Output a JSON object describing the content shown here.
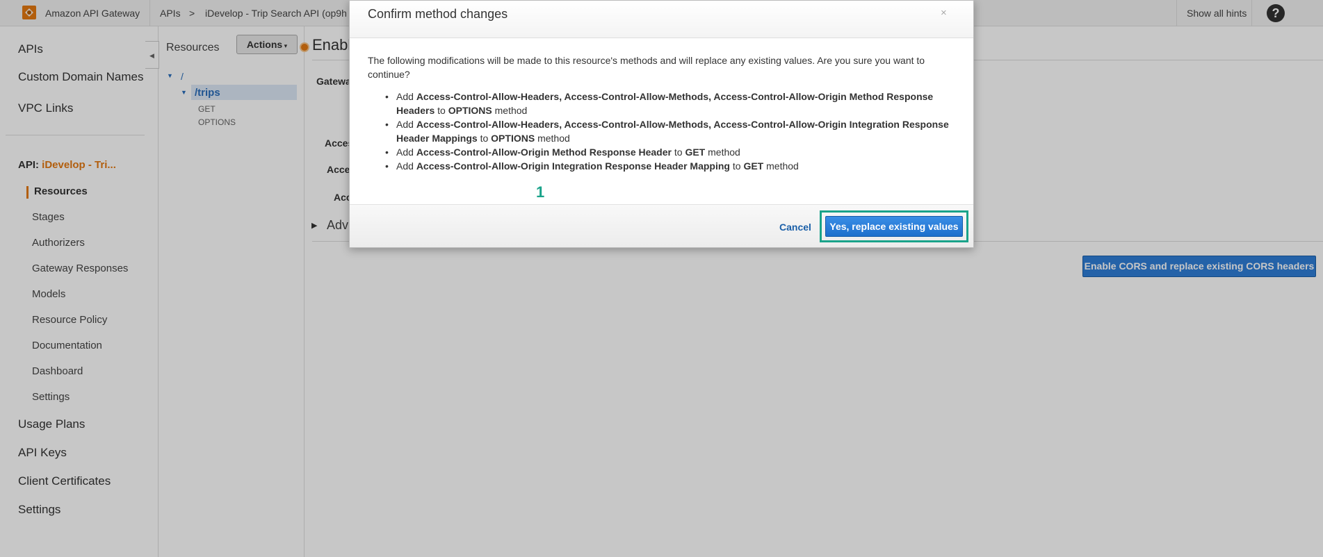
{
  "topbar": {
    "brand": "Amazon API Gateway",
    "breadcrumb_apis": "APIs",
    "breadcrumb_sep": ">",
    "breadcrumb_api": "iDevelop - Trip Search API (op9h",
    "show_hints": "Show all hints",
    "help": "?"
  },
  "leftnav": {
    "top_items": [
      "APIs",
      "Custom Domain Names",
      "VPC Links"
    ],
    "api_prefix": "API:",
    "api_name": "iDevelop - Tri...",
    "sub_items": [
      "Resources",
      "Stages",
      "Authorizers",
      "Gateway Responses",
      "Models",
      "Resource Policy",
      "Documentation",
      "Dashboard",
      "Settings"
    ],
    "bottom_items": [
      "Usage Plans",
      "API Keys",
      "Client Certificates",
      "Settings"
    ]
  },
  "resources": {
    "title": "Resources",
    "actions_label": "Actions",
    "root": "/",
    "trips": "/trips",
    "methods": [
      "GET",
      "OPTIONS"
    ]
  },
  "main": {
    "title": "Enabl",
    "gateway_label": "Gatewa",
    "access_labels": [
      "Acces",
      "Acces",
      "Acc"
    ],
    "advanced_label": "Adv",
    "cors_button": "Enable CORS and replace existing CORS headers"
  },
  "modal": {
    "title": "Confirm method changes",
    "close": "×",
    "body": "The following modifications will be made to this resource's methods and will replace any existing values. Are you sure you want to continue?",
    "items": [
      {
        "pre": "Add",
        "bold1": "Access-Control-Allow-Headers, Access-Control-Allow-Methods, Access-Control-Allow-Origin Method Response Headers",
        "mid": "to",
        "bold2": "OPTIONS",
        "post": "method"
      },
      {
        "pre": "Add",
        "bold1": "Access-Control-Allow-Headers, Access-Control-Allow-Methods, Access-Control-Allow-Origin Integration Response Header Mappings",
        "mid": "to",
        "bold2": "OPTIONS",
        "post": "method"
      },
      {
        "pre": "Add",
        "bold1": "Access-Control-Allow-Origin Method Response Header",
        "mid": "to",
        "bold2": "GET",
        "post": "method"
      },
      {
        "pre": "Add",
        "bold1": "Access-Control-Allow-Origin Integration Response Header Mapping",
        "mid": "to",
        "bold2": "GET",
        "post": "method"
      }
    ],
    "cancel": "Cancel",
    "confirm": "Yes, replace existing values"
  },
  "annotation": {
    "number": "1",
    "color": "#1aa38a"
  },
  "colors": {
    "accent": "#e47911",
    "link": "#2a6ebb",
    "primary_button": "#2f7ed8"
  }
}
